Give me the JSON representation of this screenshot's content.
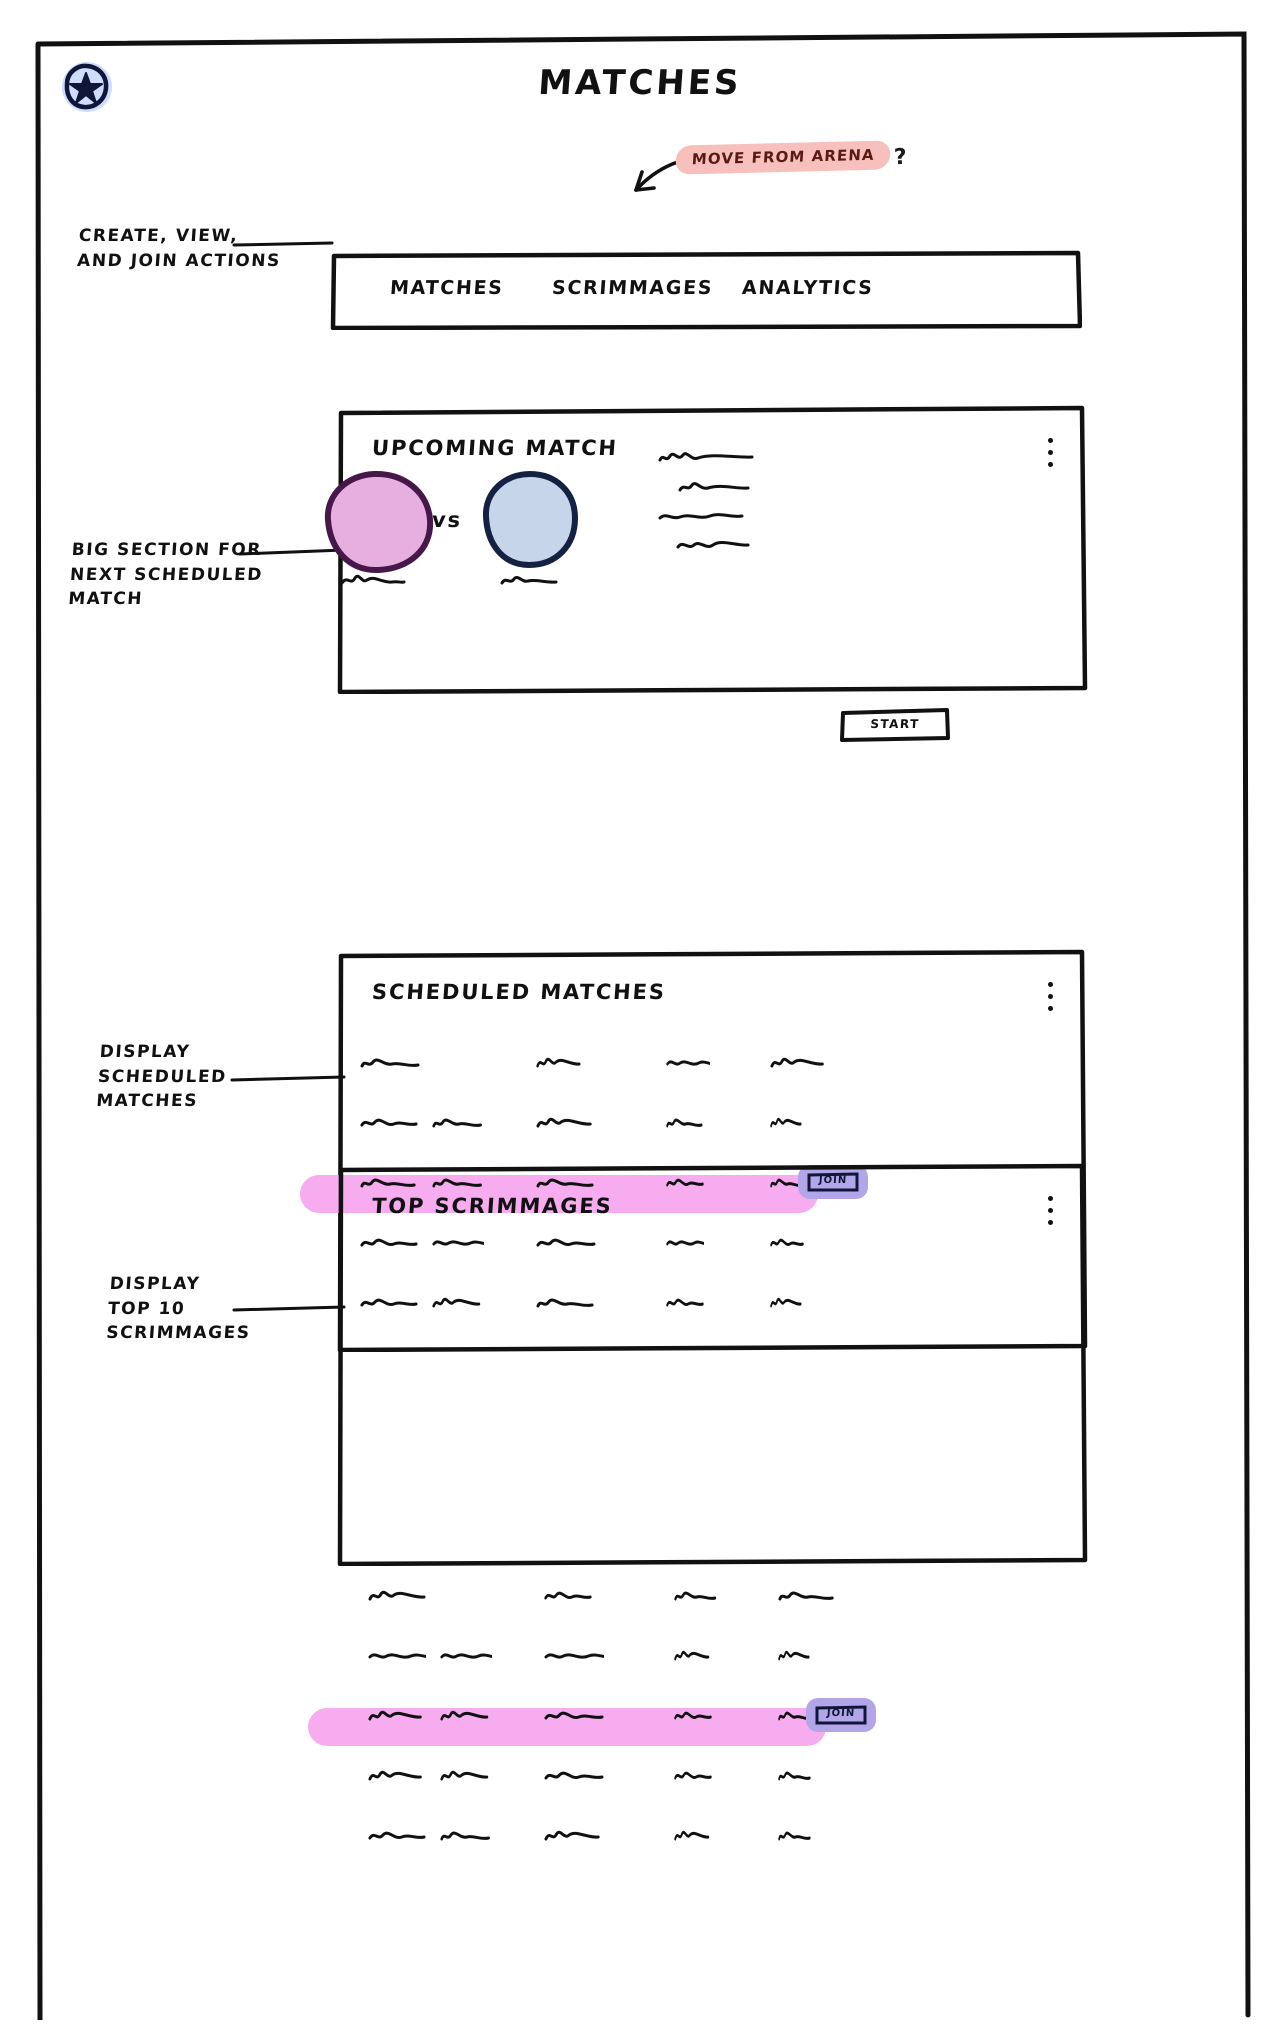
{
  "app": {
    "logo_icon": "star-in-circle-icon",
    "title": "MATCHES"
  },
  "notes": {
    "arena": {
      "text": "MOVE FROM ARENA",
      "suffix": "?",
      "highlight_color": "#f7c0bc"
    },
    "nav": {
      "line1": "CREATE, VIEW,",
      "line2": "AND JOIN ACTIONS"
    },
    "upcoming": {
      "line1": "BIG SECTION FOR",
      "line2": "NEXT SCHEDULED",
      "line3": "MATCH"
    },
    "scheduled": {
      "line1": "DISPLAY",
      "line2": "SCHEDULED",
      "line3": "MATCHES"
    },
    "scrimmages": {
      "line1": "DISPLAY",
      "line2": "TOP 10",
      "line3": "SCRIMMAGES"
    }
  },
  "nav": {
    "tabs": [
      {
        "label": "MATCHES"
      },
      {
        "label": "SCRIMMAGES"
      },
      {
        "label": "ANALYTICS"
      }
    ]
  },
  "upcoming_match": {
    "title": "UPCOMING MATCH",
    "menu_icon": "kebab-menu-icon",
    "team_a": {
      "name_placeholder": "squiggle-label",
      "fill": "#e7aee0",
      "stroke": "#46184a"
    },
    "team_b": {
      "name_placeholder": "squiggle-label",
      "fill": "#c6d5ea",
      "stroke": "#152142"
    },
    "versus_label": "vs",
    "detail_lines": 4,
    "start_button": {
      "label": "START"
    }
  },
  "scheduled_matches": {
    "title": "SCHEDULED MATCHES",
    "menu_icon": "kebab-menu-icon",
    "rows": [
      {
        "highlighted": false,
        "header": true
      },
      {
        "highlighted": false
      },
      {
        "highlighted": true,
        "action": {
          "label": "JOIN"
        }
      },
      {
        "highlighted": false
      },
      {
        "highlighted": false
      }
    ],
    "highlight_color": "#f5a8ee",
    "action_color": "#b3a6e8"
  },
  "top_scrimmages": {
    "title": "TOP SCRIMMAGES",
    "menu_icon": "kebab-menu-icon",
    "rows": [
      {
        "highlighted": false,
        "header": true
      },
      {
        "highlighted": false
      },
      {
        "highlighted": true,
        "action": {
          "label": "JOIN"
        }
      },
      {
        "highlighted": false
      },
      {
        "highlighted": false
      }
    ],
    "highlight_color": "#f5a8ee",
    "action_color": "#b3a6e8"
  }
}
